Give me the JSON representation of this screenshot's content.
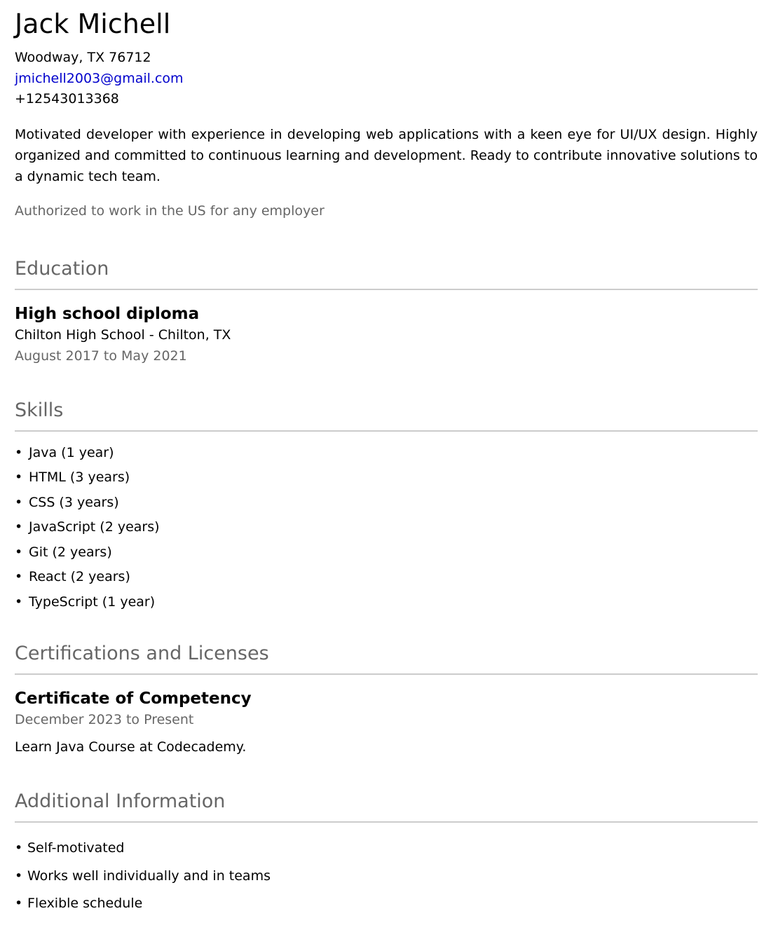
{
  "header": {
    "name": "Jack Michell",
    "location": "Woodway, TX 76712",
    "email": "jmichell2003@gmail.com",
    "phone": "+12543013368"
  },
  "summary": "Motivated developer with experience in developing web applications with a keen eye for UI/UX design. Highly organized and committed to continuous learning and development. Ready to contribute innovative solutions to a dynamic tech team.",
  "authorization": "Authorized to work in the US for any employer",
  "education": {
    "title": "Education",
    "degree": "High school diploma",
    "school": "Chilton High School - Chilton, TX",
    "dates": "August 2017 to May 2021"
  },
  "skills": {
    "title": "Skills",
    "items": [
      "Java (1 year)",
      "HTML (3 years)",
      "CSS (3 years)",
      "JavaScript (2 years)",
      "Git (2 years)",
      "React (2 years)",
      "TypeScript (1 year)"
    ]
  },
  "certifications": {
    "title": "Certifications and Licenses",
    "name": "Certificate of Competency",
    "dates": "December 2023 to Present",
    "description": "Learn Java Course at Codecademy."
  },
  "additional": {
    "title": "Additional Information",
    "items": [
      "Self-motivated",
      "Works well individually and in teams",
      "Flexible schedule"
    ]
  },
  "colors": {
    "link": "#0000cc",
    "muted": "#666666",
    "divider": "#cccccc"
  },
  "bullet": "•"
}
